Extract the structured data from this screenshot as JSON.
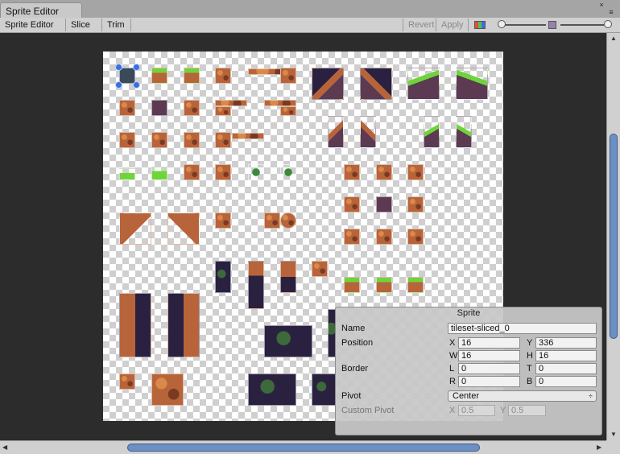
{
  "window": {
    "tab_title": "Sprite Editor",
    "close_glyph": "×",
    "menu_glyph": "≡"
  },
  "toolbar": {
    "sprite_editor": "Sprite Editor ÷",
    "slice": "Slice ÷",
    "trim": "Trim",
    "revert": "Revert",
    "apply": "Apply"
  },
  "sprite_panel": {
    "title": "Sprite",
    "name_label": "Name",
    "name_value": "tileset-sliced_0",
    "position_label": "Position",
    "x_label": "X",
    "x_value": "16",
    "y_label": "Y",
    "y_value": "336",
    "w_label": "W",
    "w_value": "16",
    "h_label": "H",
    "h_value": "16",
    "border_label": "Border",
    "l_label": "L",
    "l_value": "0",
    "t_label": "T",
    "t_value": "0",
    "r_label": "R",
    "r_value": "0",
    "b_label": "B",
    "b_value": "0",
    "pivot_label": "Pivot",
    "pivot_value": "Center",
    "custom_pivot_label": "Custom Pivot",
    "cx_label": "X",
    "cx_value": "0.5",
    "cy_label": "Y",
    "cy_value": "0.5"
  },
  "colors": {
    "scroll_thumb": "#6c8fc4",
    "viewport_bg": "#2c2c2c",
    "selection": "#3b6fe0"
  }
}
